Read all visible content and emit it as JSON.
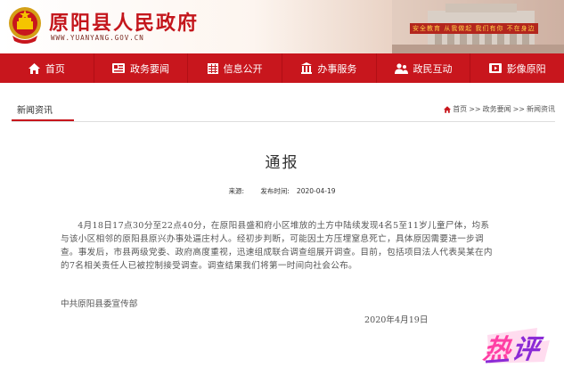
{
  "header": {
    "title": "原阳县人民政府",
    "url": "WWW.YUANYANG.GOV.CN",
    "banner_text": "安全教育 从我做起 我们有你 不在身边"
  },
  "nav": {
    "items": [
      {
        "label": "首页",
        "icon": "home-icon"
      },
      {
        "label": "政务要闻",
        "icon": "news-icon"
      },
      {
        "label": "信息公开",
        "icon": "grid-icon"
      },
      {
        "label": "办事服务",
        "icon": "building-icon"
      },
      {
        "label": "政民互动",
        "icon": "people-icon"
      },
      {
        "label": "影像原阳",
        "icon": "film-icon"
      }
    ]
  },
  "section": {
    "tab": "新闻资讯",
    "breadcrumb": [
      "首页",
      "政务要闻",
      "新闻资讯"
    ],
    "breadcrumb_sep": ">>"
  },
  "article": {
    "title": "通报",
    "source_label": "来源:",
    "source_value": "",
    "published_label": "发布时间:",
    "published_value": "2020-04-19",
    "body": "4月18日17点30分至22点40分，在原阳县盛和府小区堆放的土方中陆续发现4名5至11岁儿童尸体，均系与该小区相邻的原阳县原兴办事处逼庄村人。经初步判断，可能因土方压埋窒息死亡，具体原因需要进一步调查。事发后，市县两级党委、政府高度重视，迅速组成联合调查组展开调查。目前，包括项目法人代表吴某在内的7名相关责任人已被控制接受调查。调查结果我们将第一时间向社会公布。",
    "signature": "中共原阳县委宣传部",
    "date": "2020年4月19日"
  },
  "badge": {
    "text": "热评"
  },
  "colors": {
    "brand_red": "#c8161d",
    "title_red": "#c4161c",
    "badge_purple": "#8b2bd6",
    "badge_pink": "#ff3fa4"
  }
}
